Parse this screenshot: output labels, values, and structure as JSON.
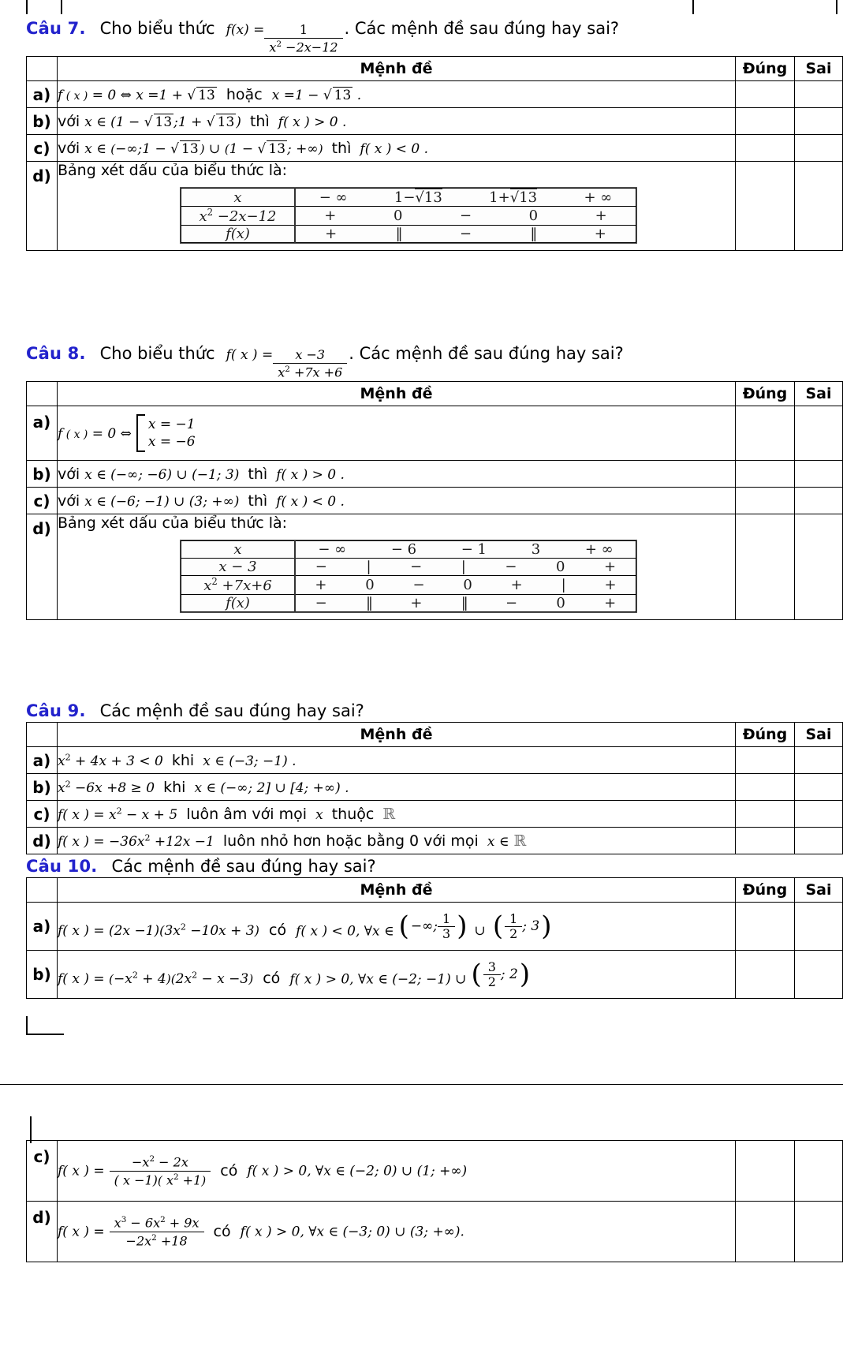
{
  "document": {
    "language": "vi",
    "type": "math-worksheet",
    "accent_color": "#2222cc"
  },
  "table_headers": {
    "statement": "Mệnh đề",
    "true": "Đúng",
    "false": "Sai"
  },
  "questions": [
    {
      "id": "cau7",
      "label": "Câu 7.",
      "prompt_before": "Cho biểu thức",
      "expression": {
        "numerator": "1",
        "denominator": "x² − 2x − 12"
      },
      "prompt_after": ". Các mệnh đề sau đúng hay sai?",
      "items": [
        {
          "letter": "a)",
          "text": "f(x) = 0 ⇔ x = 1 + √13 hoặc x = 1 − √13 ."
        },
        {
          "letter": "b)",
          "text": "với x ∈ (1 − √13 ; 1 + √13) thì f(x) > 0 ."
        },
        {
          "letter": "c)",
          "text": "với x ∈ (−∞;1 − √13) ∪ (1 − √13; +∞) thì f(x) < 0 ."
        },
        {
          "letter": "d)",
          "text": "Bảng xét dấu của biểu thức là:"
        }
      ],
      "sign_table": {
        "row_labels": [
          "x",
          "x² − 2x − 12",
          "f(x)"
        ],
        "x_values": [
          "− ∞",
          "1 − √13",
          "1 + √13",
          "+ ∞"
        ],
        "signs_row2": [
          "+",
          "0",
          "−",
          "0",
          "+"
        ],
        "signs_row3": [
          "+",
          "‖",
          "−",
          "‖",
          "+"
        ]
      }
    },
    {
      "id": "cau8",
      "label": "Câu 8.",
      "prompt_before": "Cho biểu thức",
      "expression": {
        "numerator": "x − 3",
        "denominator": "x² + 7x + 6"
      },
      "prompt_after": ". Các mệnh đề sau đúng hay sai?",
      "items": [
        {
          "letter": "a)",
          "text": "f(x) = 0 ⇔ [ x = −1 ; x = −6 ]"
        },
        {
          "letter": "b)",
          "text": "với x ∈ (−∞; −6) ∪ (−1; 3) thì f(x) > 0 ."
        },
        {
          "letter": "c)",
          "text": "với x ∈ (−6; −1) ∪ (3; +∞) thì f(x) < 0 ."
        },
        {
          "letter": "d)",
          "text": "Bảng xét dấu của biểu thức là:"
        }
      ],
      "system_lines": [
        "x = −1",
        "x = −6"
      ],
      "sign_table": {
        "row_labels": [
          "x",
          "x − 3",
          "x² + 7x + 6",
          "f(x)"
        ],
        "x_values": [
          "− ∞",
          "− 6",
          "− 1",
          "3",
          "+ ∞"
        ],
        "signs_row2": [
          "−",
          "|",
          "−",
          "|",
          "−",
          "0",
          "+"
        ],
        "signs_row3": [
          "+",
          "0",
          "−",
          "0",
          "+",
          "|",
          "+"
        ],
        "signs_row4": [
          "−",
          "‖",
          "+",
          "‖",
          "−",
          "0",
          "+"
        ]
      }
    },
    {
      "id": "cau9",
      "label": "Câu 9.",
      "prompt_after": "Các mệnh đề sau đúng hay sai?",
      "items": [
        {
          "letter": "a)",
          "text": "x² + 4x + 3 < 0 khi x ∈ (−3; −1) ."
        },
        {
          "letter": "b)",
          "text": "x² − 6x + 8 ≥ 0 khi x ∈ (−∞; 2] ∪ [4; +∞) ."
        },
        {
          "letter": "c)",
          "text": "f(x) = x² − x + 5 luôn âm với mọi x thuộc ℝ"
        },
        {
          "letter": "d)",
          "text": "f(x) = −36x² + 12x − 1 luôn nhỏ hơn hoặc bằng 0 với mọi x ∈ ℝ"
        }
      ]
    },
    {
      "id": "cau10",
      "label": "Câu 10.",
      "prompt_after": "Các mệnh đề sau đúng hay sai?",
      "items": [
        {
          "letter": "a)",
          "text": "f(x) = (2x − 1)(3x² − 10x + 3) có f(x) < 0, ∀x ∈ (−∞; 1/3) ∪ (1/2; 3)"
        },
        {
          "letter": "b)",
          "text": "f(x) = (−x² + 4)(2x² − x − 3) có f(x) > 0, ∀x ∈ (−2; −1) ∪ (3/2; 2)"
        }
      ]
    },
    {
      "id": "cau10-cont",
      "items": [
        {
          "letter": "c)",
          "text": "f(x) = (−x² − 2x) / ((x − 1)(x² + 1)) có f(x) > 0, ∀x ∈ (−2; 0) ∪ (1; +∞)"
        },
        {
          "letter": "d)",
          "text": "f(x) = (x³ − 6x² + 9x) / (−2x² + 18) có f(x) > 0, ∀x ∈ (−3; 0) ∪ (3; +∞)."
        }
      ]
    }
  ]
}
